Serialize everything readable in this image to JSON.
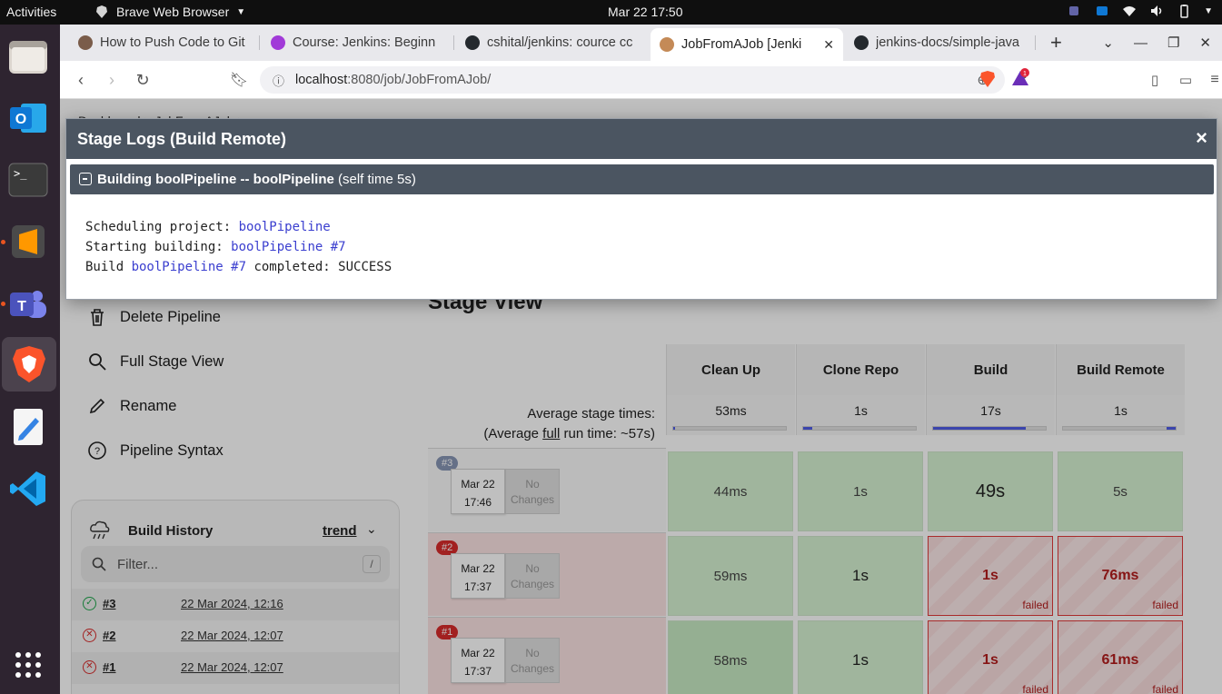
{
  "os": {
    "activities": "Activities",
    "app_name": "Brave Web Browser",
    "clock": "Mar 22  17:50"
  },
  "tabs": [
    {
      "title": "How to Push Code to Git",
      "favicon_color": "#7a5c4a"
    },
    {
      "title": "Course: Jenkins: Beginn",
      "favicon_color": "#a13ad8"
    },
    {
      "title": "cshital/jenkins: cource cc",
      "favicon_color": "#24292e"
    },
    {
      "title": "JobFromAJob [Jenki",
      "favicon_color": "#c48a57"
    },
    {
      "title": "jenkins-docs/simple-java",
      "favicon_color": "#24292e"
    }
  ],
  "address": {
    "host": "localhost",
    "path": ":8080/job/JobFromAJob/"
  },
  "breadcrumb": {
    "text": "Dashboard  >  JobFromAJob  >"
  },
  "sidebar": {
    "items": [
      {
        "label": "Delete Pipeline"
      },
      {
        "label": "Full Stage View"
      },
      {
        "label": "Rename"
      },
      {
        "label": "Pipeline Syntax"
      }
    ]
  },
  "build_history": {
    "title": "Build History",
    "trend": "trend",
    "filter_placeholder": "Filter...",
    "filter_key": "/",
    "builds": [
      {
        "number": "#3",
        "date": "22 Mar 2024, 12:16",
        "status": "success"
      },
      {
        "number": "#2",
        "date": "22 Mar 2024, 12:07",
        "status": "failed"
      },
      {
        "number": "#1",
        "date": "22 Mar 2024, 12:07",
        "status": "failed"
      }
    ]
  },
  "stage_view": {
    "title": "Stage View",
    "avg_label_1": "Average stage times:",
    "avg_label_2a": "(Average ",
    "avg_label_2b": "full",
    "avg_label_2c": " run time: ~57s)",
    "stages": [
      {
        "name": "Clean Up",
        "avg": "53ms",
        "fill": 0.02
      },
      {
        "name": "Clone Repo",
        "avg": "1s",
        "fill": 0.08
      },
      {
        "name": "Build",
        "avg": "17s",
        "fill": 0.82
      },
      {
        "name": "Build Remote",
        "avg": "1s",
        "fill": 0.08
      }
    ],
    "no_changes": "No Changes",
    "failed_label": "failed",
    "runs": [
      {
        "badge": "#3",
        "date": "Mar 22",
        "time": "17:46",
        "status": "success",
        "cells": [
          {
            "v": "44ms",
            "s": "ok"
          },
          {
            "v": "1s",
            "s": "ok"
          },
          {
            "v": "49s",
            "s": "ok"
          },
          {
            "v": "5s",
            "s": "ok"
          }
        ]
      },
      {
        "badge": "#2",
        "date": "Mar 22",
        "time": "17:37",
        "status": "failed",
        "cells": [
          {
            "v": "59ms",
            "s": "ok"
          },
          {
            "v": "1s",
            "s": "ok"
          },
          {
            "v": "1s",
            "s": "fail"
          },
          {
            "v": "76ms",
            "s": "fail"
          }
        ]
      },
      {
        "badge": "#1",
        "date": "Mar 22",
        "time": "17:37",
        "status": "failed",
        "cells": [
          {
            "v": "58ms",
            "s": "ok"
          },
          {
            "v": "1s",
            "s": "ok"
          },
          {
            "v": "1s",
            "s": "fail"
          },
          {
            "v": "61ms",
            "s": "fail"
          }
        ]
      }
    ]
  },
  "modal": {
    "title": "Stage Logs (Build Remote)",
    "close": "×",
    "step_bold": "Building boolPipeline -- boolPipeline",
    "step_rest": " (self time 5s)",
    "log": {
      "l1_text": "Scheduling project: ",
      "l1_link": "boolPipeline",
      "l2_text": "Starting building: ",
      "l2_link": "boolPipeline #7",
      "l3_text": "Build ",
      "l3_link": "boolPipeline #7",
      "l3_rest": " completed: SUCCESS"
    }
  }
}
